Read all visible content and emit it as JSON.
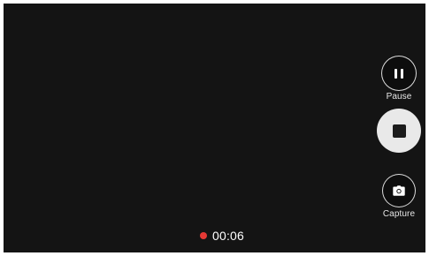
{
  "controls": {
    "pause_label": "Pause",
    "capture_label": "Capture"
  },
  "recording": {
    "elapsed": "00:06",
    "indicator_color": "#e53935"
  },
  "icons": {
    "pause": "pause-icon",
    "stop": "stop-icon",
    "capture": "camera-icon",
    "recording": "recording-dot-icon"
  }
}
